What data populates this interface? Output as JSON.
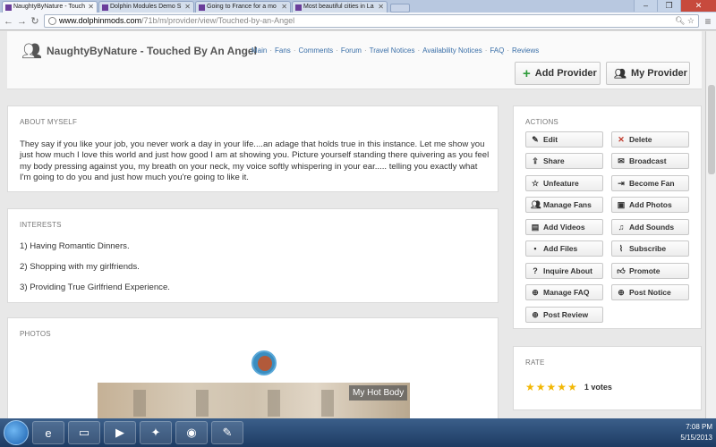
{
  "browser": {
    "tabs": [
      {
        "title": "NaughtyByNature - Touch",
        "active": true
      },
      {
        "title": "Dolphin Modules Demo S",
        "active": false
      },
      {
        "title": "Going to France for a mo",
        "active": false
      },
      {
        "title": "Most beautiful cities in La",
        "active": false
      }
    ],
    "url_host": "www.dolphinmods.com",
    "url_path": "/71b/m/provider/view/Touched-by-an-Angel",
    "window_controls": [
      "–",
      "❐",
      "✕"
    ]
  },
  "header": {
    "title": "NaughtyByNature - Touched By An Angel",
    "links": [
      "Main",
      "Fans",
      "Comments",
      "Forum",
      "Travel Notices",
      "Availability Notices",
      "FAQ",
      "Reviews"
    ],
    "add_provider": "Add Provider",
    "my_provider": "My Provider"
  },
  "about": {
    "heading": "ABOUT MYSELF",
    "text": "They say if you like your job, you never work a day in your life....an adage that holds true in this instance. Let me show you just how much I love this world and just how good I am at showing you. Picture yourself standing there quivering as you feel my body pressing against you, my breath on your neck, my voice softly whispering in your ear..... telling you exactly what I'm going to do you and just how much you're going to like it."
  },
  "interests": {
    "heading": "INTERESTS",
    "items": [
      "1) Having Romantic Dinners.",
      "2) Shopping with my girlfriends.",
      "3) Providing True Girlfriend Experience."
    ]
  },
  "photos": {
    "heading": "PHOTOS",
    "caption": "My Hot Body"
  },
  "actions": {
    "heading": "ACTIONS",
    "items": [
      {
        "label": "Edit",
        "icon": "edit-icon"
      },
      {
        "label": "Delete",
        "icon": "delete-icon"
      },
      {
        "label": "Share",
        "icon": "share-icon"
      },
      {
        "label": "Broadcast",
        "icon": "broadcast-icon"
      },
      {
        "label": "Unfeature",
        "icon": "star-outline-icon"
      },
      {
        "label": "Become Fan",
        "icon": "sign-in-icon"
      },
      {
        "label": "Manage Fans",
        "icon": "users-icon"
      },
      {
        "label": "Add Photos",
        "icon": "photo-icon"
      },
      {
        "label": "Add Videos",
        "icon": "film-icon"
      },
      {
        "label": "Add Sounds",
        "icon": "music-icon"
      },
      {
        "label": "Add Files",
        "icon": "save-icon"
      },
      {
        "label": "Subscribe",
        "icon": "paperclip-icon"
      },
      {
        "label": "Inquire About",
        "icon": "question-icon"
      },
      {
        "label": "Promote",
        "icon": "thumbs-up-icon"
      },
      {
        "label": "Manage FAQ",
        "icon": "plus-circle-icon"
      },
      {
        "label": "Post Notice",
        "icon": "plus-circle-icon"
      },
      {
        "label": "Post Review",
        "icon": "plus-circle-icon"
      }
    ]
  },
  "rate": {
    "heading": "RATE",
    "stars": 5,
    "votes": "1 votes"
  },
  "taskbar": {
    "time": "7:08 PM",
    "date": "5/15/2013"
  }
}
